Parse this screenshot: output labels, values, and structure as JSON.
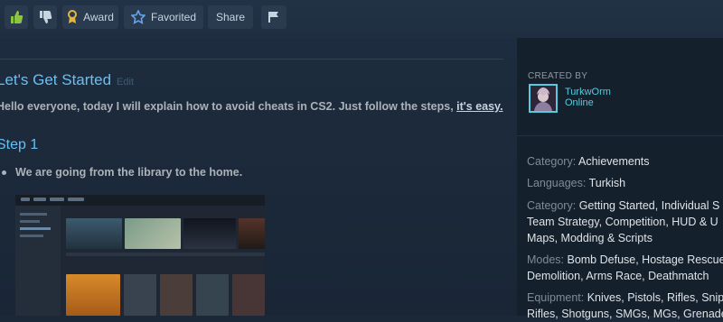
{
  "toolbar": {
    "like_icon": "thumbs-up-icon",
    "dislike_icon": "thumbs-down-icon",
    "award": {
      "label": "Award",
      "icon": "award-ribbon-icon"
    },
    "favorited": {
      "label": "Favorited",
      "icon": "star-icon"
    },
    "share": {
      "label": "Share"
    },
    "flag_icon": "flag-icon"
  },
  "guide": {
    "section_title": "Let's Get Started",
    "edit_label": "Edit",
    "intro_text": "Hello everyone, today I will explain how to avoid cheats in CS2. Just follow the steps, ",
    "intro_link": "it's easy.",
    "step_title": "Step 1",
    "bullet": "We are going from the library to the home."
  },
  "sidebar": {
    "created_by_label": "CREATED BY",
    "author_name": "TurkwOrm",
    "author_status": "Online",
    "categories": [
      {
        "key": "Category:",
        "values": [
          "Achievements"
        ]
      },
      {
        "key": "Languages:",
        "values": [
          "Turkish"
        ]
      },
      {
        "key": "Category:",
        "values": [
          "Getting Started",
          "Individual S",
          "Team Strategy",
          "Competition",
          "HUD & U",
          "Maps",
          "Modding & Scripts"
        ]
      },
      {
        "key": "Modes:",
        "values": [
          "Bomb Defuse",
          "Hostage Rescue",
          "Demolition",
          "Arms Race",
          "Deathmatch"
        ]
      },
      {
        "key": "Equipment:",
        "values": [
          "Knives",
          "Pistols",
          "Rifles",
          "Snipe",
          "Rifles",
          "Shotguns",
          "SMGs",
          "MGs",
          "Grenade"
        ]
      }
    ]
  },
  "colors": {
    "accent": "#66c0f4",
    "online": "#57cbde",
    "background": "#1b2838"
  }
}
